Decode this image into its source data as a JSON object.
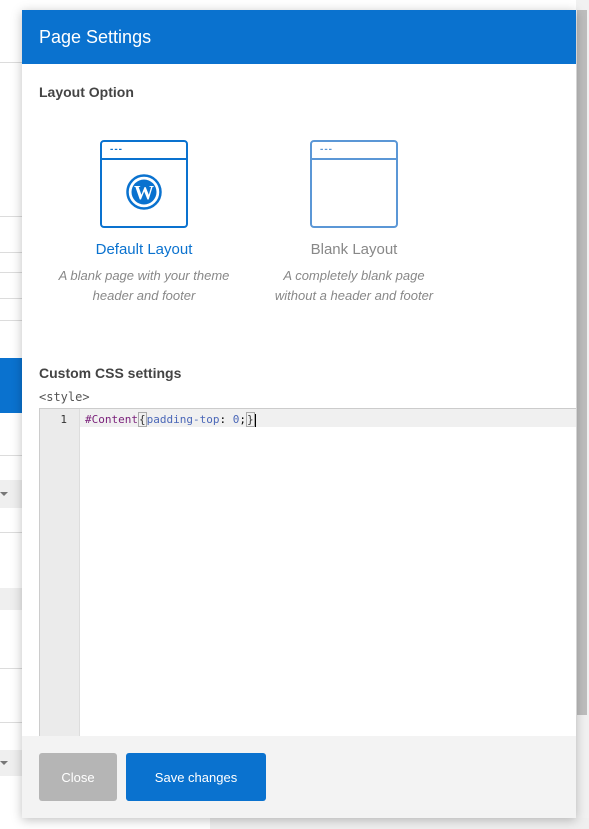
{
  "modal": {
    "title": "Page Settings"
  },
  "layout": {
    "section_title": "Layout Option",
    "options": [
      {
        "name": "Default Layout",
        "desc_line1": "A blank page with your theme",
        "desc_line2": "header and footer",
        "icon": "wordpress-icon",
        "selected": true
      },
      {
        "name": "Blank Layout",
        "desc_line1": "A completely blank page",
        "desc_line2": "without a header and footer",
        "icon": "blank-window-icon",
        "selected": false
      }
    ]
  },
  "css": {
    "section_title": "Custom CSS settings",
    "style_tag": "<style>",
    "line_number": "1",
    "code_selector": "#Content",
    "code_open": "{",
    "code_property": "padding-top",
    "code_colon": ": ",
    "code_value": "0",
    "code_semicolon": ";",
    "code_close": "}"
  },
  "footer": {
    "close_label": "Close",
    "save_label": "Save changes"
  },
  "colors": {
    "accent": "#0a72cf",
    "close_button": "#b5b5b5"
  }
}
